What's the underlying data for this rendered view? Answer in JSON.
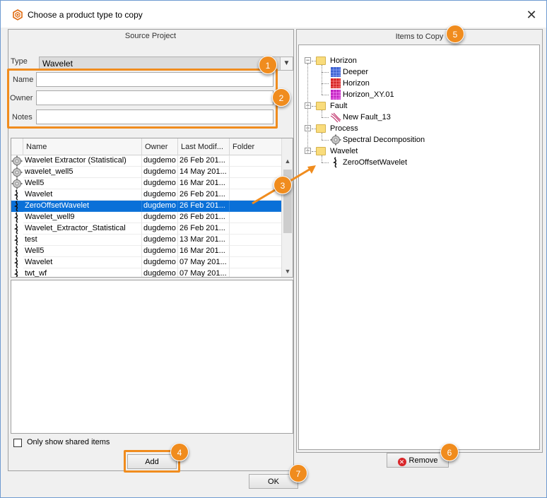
{
  "window": {
    "title": "Choose a product type to copy"
  },
  "source": {
    "header": "Source Project",
    "type_label": "Type",
    "type_value": "Wavelet",
    "name_label": "Name",
    "owner_label": "Owner",
    "notes_label": "Notes",
    "name_value": "",
    "owner_value": "",
    "notes_value": "",
    "columns": [
      "Name",
      "Owner",
      "Last Modif...",
      "Folder"
    ],
    "rows": [
      {
        "icon": "gear-icon",
        "name": "Wavelet Extractor (Statistical)",
        "owner": "dugdemo",
        "modified": "26 Feb 201...",
        "folder": ""
      },
      {
        "icon": "gear-icon",
        "name": "wavelet_well5",
        "owner": "dugdemo",
        "modified": "14 May 201...",
        "folder": ""
      },
      {
        "icon": "gear-icon",
        "name": "Well5",
        "owner": "dugdemo",
        "modified": "16 Mar 201...",
        "folder": ""
      },
      {
        "icon": "wavelet-icon",
        "name": "Wavelet",
        "owner": "dugdemo",
        "modified": "26 Feb 201...",
        "folder": ""
      },
      {
        "icon": "wavelet-icon",
        "name": "ZeroOffsetWavelet",
        "owner": "dugdemo",
        "modified": "26 Feb 201...",
        "folder": "",
        "selected": true
      },
      {
        "icon": "wavelet-icon",
        "name": "Wavelet_well9",
        "owner": "dugdemo",
        "modified": "26 Feb 201...",
        "folder": ""
      },
      {
        "icon": "wavelet-icon",
        "name": "Wavelet_Extractor_Statistical",
        "owner": "dugdemo",
        "modified": "26 Feb 201...",
        "folder": ""
      },
      {
        "icon": "wavelet-icon",
        "name": "test",
        "owner": "dugdemo",
        "modified": "13 Mar 201...",
        "folder": ""
      },
      {
        "icon": "wavelet-icon",
        "name": "Well5",
        "owner": "dugdemo",
        "modified": "16 Mar 201...",
        "folder": ""
      },
      {
        "icon": "wavelet-icon",
        "name": "Wavelet",
        "owner": "dugdemo",
        "modified": "07 May 201...",
        "folder": ""
      },
      {
        "icon": "wavelet-icon",
        "name": "twt_wf",
        "owner": "dugdemo",
        "modified": "07 May 201...",
        "folder": ""
      }
    ],
    "only_shared_label": "Only show shared items",
    "only_shared_checked": false,
    "add_label": "Add"
  },
  "items": {
    "header": "Items to Copy",
    "tree": [
      {
        "label": "Horizon",
        "children": [
          {
            "label": "Deeper",
            "icon": "horizon-blue-icon"
          },
          {
            "label": "Horizon",
            "icon": "horizon-red-icon"
          },
          {
            "label": "Horizon_XY.01",
            "icon": "horizon-magenta-icon"
          }
        ]
      },
      {
        "label": "Fault",
        "children": [
          {
            "label": "New Fault_13",
            "icon": "fault-icon"
          }
        ]
      },
      {
        "label": "Process",
        "children": [
          {
            "label": "Spectral Decomposition",
            "icon": "gear-icon"
          }
        ]
      },
      {
        "label": "Wavelet",
        "children": [
          {
            "label": "ZeroOffsetWavelet",
            "icon": "wavelet-icon"
          }
        ]
      }
    ],
    "remove_label": "Remove"
  },
  "ok_label": "OK",
  "callouts": [
    "1",
    "2",
    "3",
    "4",
    "5",
    "6",
    "7"
  ],
  "colors": {
    "accent": "#f08c1e",
    "selection": "#0a70d8"
  }
}
